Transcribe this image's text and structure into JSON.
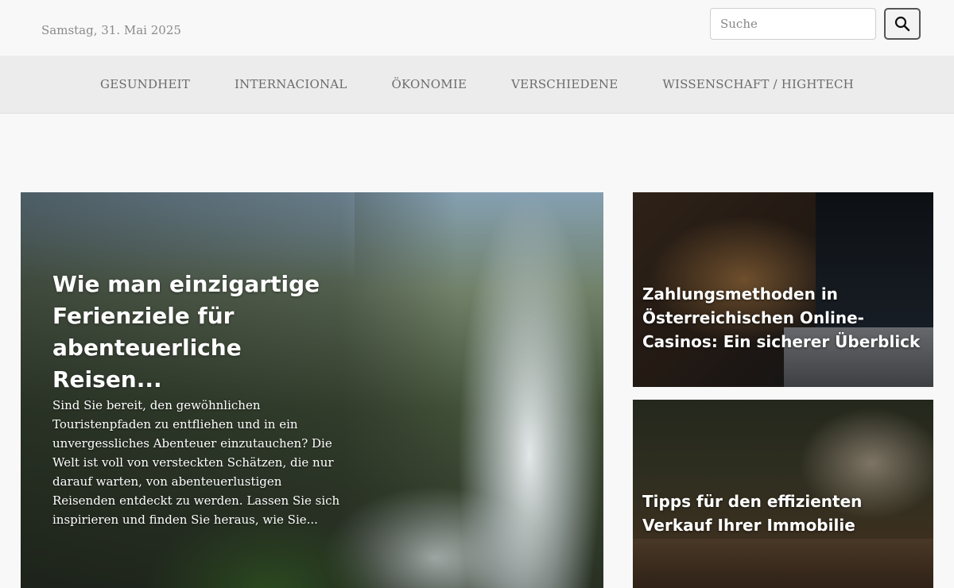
{
  "header": {
    "date": "Samstag, 31. Mai 2025",
    "search_placeholder": "Suche"
  },
  "nav": {
    "items": [
      {
        "label": "GESUNDHEIT"
      },
      {
        "label": "INTERNACIONAL"
      },
      {
        "label": "ÖKONOMIE"
      },
      {
        "label": "VERSCHIEDENE"
      },
      {
        "label": "WISSENSCHAFT / HIGHTECH"
      }
    ]
  },
  "featured": {
    "title": "Wie man einzigartige Ferienziele für abenteuerliche Reisen...",
    "excerpt": "Sind Sie bereit, den gewöhnlichen Touristenpfaden zu entfliehen und in ein unvergessliches Abenteuer einzutauchen? Die Welt ist voll von versteckten Schätzen, die nur darauf warten, von abenteuerlustigen Reisenden entdeckt zu werden. Lassen Sie sich inspirieren und finden Sie heraus, wie Sie..."
  },
  "side_articles": [
    {
      "title": "Zahlungsmethoden in Österreichischen Online-Casinos: Ein sicherer Überblick"
    },
    {
      "title": "Tipps für den effizienten Verkauf Ihrer Immobilie"
    }
  ],
  "icons": {
    "search": "search-icon"
  }
}
